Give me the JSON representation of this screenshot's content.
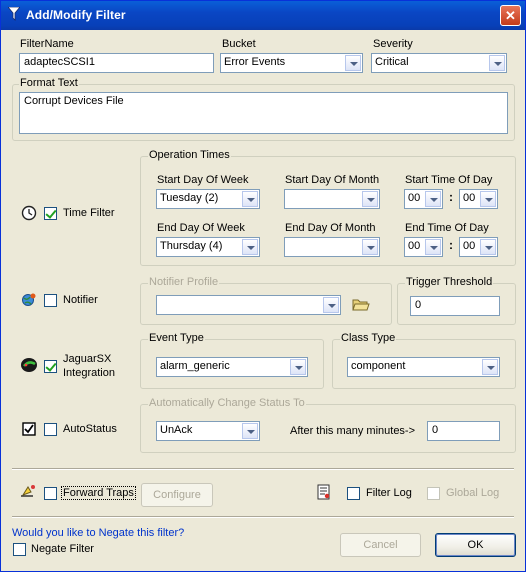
{
  "window": {
    "title": "Add/Modify Filter",
    "close_glyph": "✕"
  },
  "filter_name": {
    "label": "FilterName",
    "value": "adaptecSCSI1"
  },
  "bucket": {
    "label": "Bucket",
    "value": "Error Events"
  },
  "severity": {
    "label": "Severity",
    "value": "Critical"
  },
  "format_text": {
    "label": "Format Text",
    "value": "Corrupt Devices File"
  },
  "time_filter": {
    "checkbox_label": "Time Filter",
    "checked": true,
    "icon": "clock-icon",
    "group_title": "Operation Times",
    "start_day_of_week": {
      "label": "Start Day Of Week",
      "value": "Tuesday (2)"
    },
    "start_day_of_month": {
      "label": "Start Day Of Month",
      "value": ""
    },
    "start_time_of_day": {
      "label": "Start Time Of Day",
      "hour": "00",
      "minute": "00"
    },
    "end_day_of_week": {
      "label": "End Day Of Week",
      "value": "Thursday (4)"
    },
    "end_day_of_month": {
      "label": "End Day Of Month",
      "value": ""
    },
    "end_time_of_day": {
      "label": "End Time Of Day",
      "hour": "00",
      "minute": "00"
    },
    "separator": ":"
  },
  "notifier": {
    "checkbox_label": "Notifier",
    "checked": false,
    "icon": "notifier-globe-icon",
    "profile_title": "Notifier Profile",
    "profile_value": "",
    "trigger_threshold": {
      "label": "Trigger Threshold",
      "value": "0"
    }
  },
  "jaguar": {
    "checkbox_label_line1": "JaguarSX",
    "checkbox_label_line2": "Integration",
    "checked": true,
    "icon": "jaguar-icon",
    "event_type": {
      "label": "Event Type",
      "value": "alarm_generic"
    },
    "class_type": {
      "label": "Class Type",
      "value": "component"
    }
  },
  "autostatus": {
    "checkbox_label": "AutoStatus",
    "checked": false,
    "icon": "checkbox-icon",
    "group_title": "Automatically Change Status To",
    "status_value": "UnAck",
    "minutes_label": "After this many minutes->",
    "minutes_value": "0"
  },
  "forward_traps": {
    "label": "Forward Traps",
    "checked": false,
    "icon": "trap-icon",
    "configure_label": "Configure"
  },
  "filter_log": {
    "label": "Filter Log",
    "checked": false,
    "icon": "log-icon"
  },
  "global_log": {
    "label": "Global Log",
    "checked": false
  },
  "negate": {
    "question": "Would you like to Negate this filter?",
    "label": "Negate Filter",
    "checked": false
  },
  "buttons": {
    "cancel": "Cancel",
    "ok": "OK"
  },
  "colors": {
    "title_bar": "#0a46c4",
    "window_bg": "#ece9d8",
    "link_blue": "#0033cc"
  }
}
